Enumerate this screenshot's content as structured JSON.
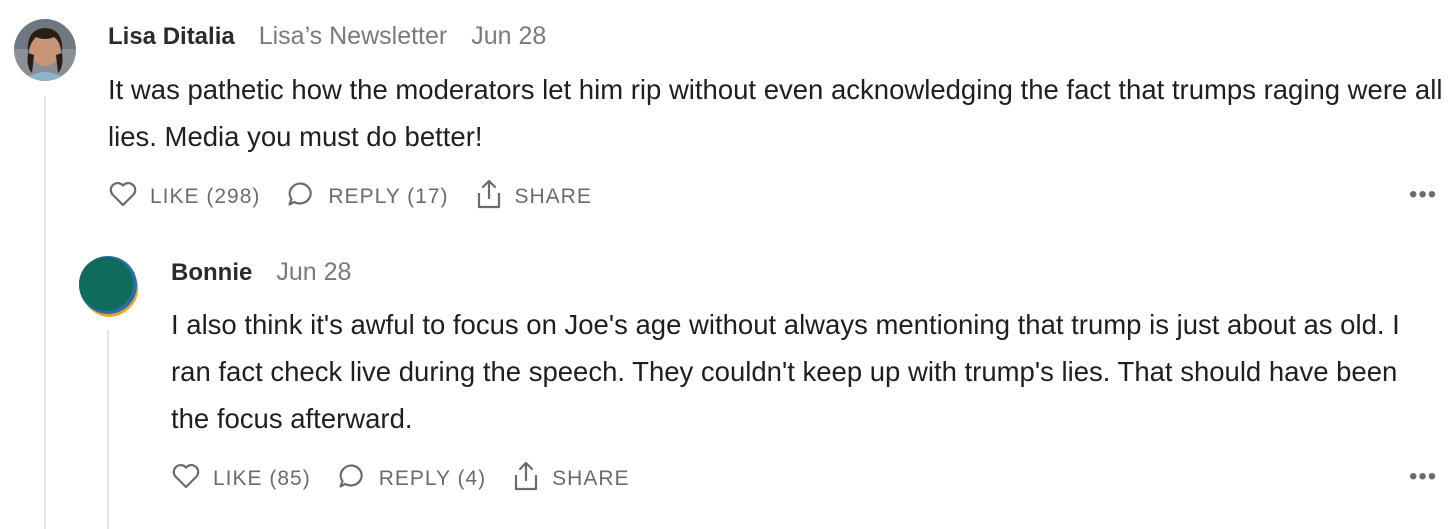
{
  "comments": [
    {
      "author": "Lisa Ditalia",
      "publication": "Lisa’s Newsletter",
      "date": "Jun 28",
      "body": "It was pathetic how the moderators let him rip without even acknowledging the fact that trumps raging were all lies. Media you must do better!",
      "like_label": "LIKE (298)",
      "reply_label": "REPLY (17)",
      "share_label": "SHARE",
      "more_label": "•••"
    },
    {
      "author": "Bonnie",
      "date": "Jun 28",
      "body": "I also think it's awful to focus on Joe's age without always mentioning that trump is just about as old. I ran fact check live during the speech. They couldn't keep up with trump's lies. That should have been the focus afterward.",
      "like_label": "LIKE (85)",
      "reply_label": "REPLY (4)",
      "share_label": "SHARE",
      "more_label": "•••"
    }
  ],
  "colors": {
    "text": "#1f1f1f",
    "muted": "#7a7a7a",
    "thread_line": "#e4e4e4",
    "avatar_teal": "#0f6b5c",
    "avatar_orange": "#f0a030",
    "avatar_blue": "#2a6ea6"
  },
  "icons": [
    "heart-icon",
    "speech-bubble-icon",
    "share-icon",
    "more-icon"
  ]
}
